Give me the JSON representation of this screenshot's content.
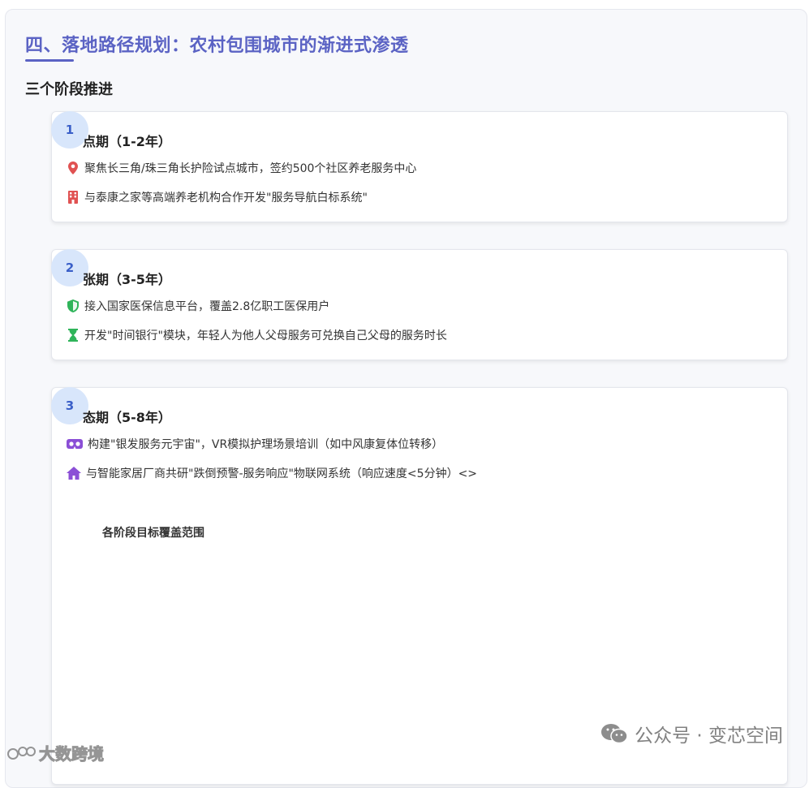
{
  "section": {
    "title": "四、落地路径规划：农村包围城市的渐进式渗透",
    "subtitle": "三个阶段推进"
  },
  "phases": [
    {
      "number": "1",
      "title": "点期（1-2年）",
      "items": [
        {
          "icon": "map-pin-icon",
          "color": "#e05252",
          "text": "聚焦长三角/珠三角长护险试点城市，签约500个社区养老服务中心"
        },
        {
          "icon": "building-icon",
          "color": "#e05252",
          "text": "与泰康之家等高端养老机构合作开发\"服务导航白标系统\""
        }
      ]
    },
    {
      "number": "2",
      "title": "张期（3-5年）",
      "items": [
        {
          "icon": "shield-icon",
          "color": "#2fb45a",
          "text": "接入国家医保信息平台，覆盖2.8亿职工医保用户"
        },
        {
          "icon": "hourglass-icon",
          "color": "#2fb45a",
          "text": "开发\"时间银行\"模块，年轻人为他人父母服务可兑换自己父母的服务时长"
        }
      ]
    },
    {
      "number": "3",
      "title": "态期（5-8年）",
      "items": [
        {
          "icon": "vr-headset-icon",
          "color": "#8b4fd6",
          "text": "构建\"银发服务元宇宙\"，VR模拟护理场景培训（如中风康复体位转移）"
        },
        {
          "icon": "home-icon",
          "color": "#8b4fd6",
          "text": "与智能家居厂商共研\"跌倒预警-服务响应\"物联网系统（响应速度<5分钟）<>"
        }
      ],
      "chart_title": "各阶段目标覆盖范围"
    }
  ],
  "watermarks": {
    "wechat": "公众号 · 变芯空间",
    "corner": "大数跨境"
  }
}
